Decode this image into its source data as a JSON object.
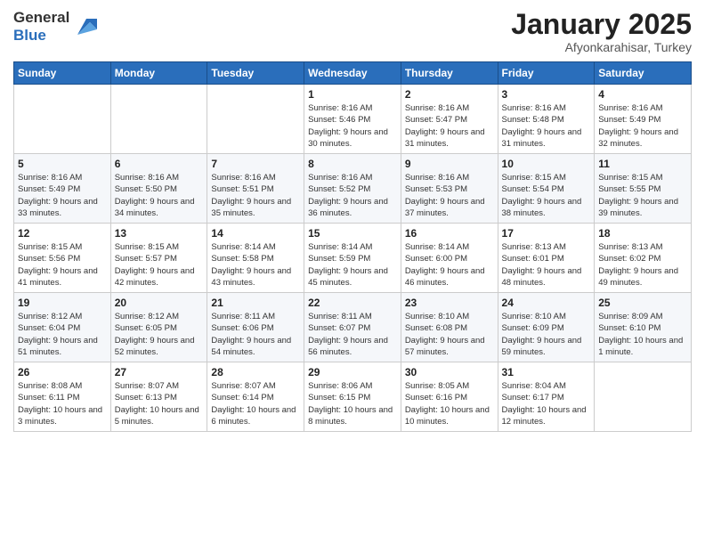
{
  "logo": {
    "line1": "General",
    "line2": "Blue"
  },
  "header": {
    "month": "January 2025",
    "location": "Afyonkarahisar, Turkey"
  },
  "weekdays": [
    "Sunday",
    "Monday",
    "Tuesday",
    "Wednesday",
    "Thursday",
    "Friday",
    "Saturday"
  ],
  "weeks": [
    [
      {
        "day": "",
        "sunrise": "",
        "sunset": "",
        "daylight": ""
      },
      {
        "day": "",
        "sunrise": "",
        "sunset": "",
        "daylight": ""
      },
      {
        "day": "",
        "sunrise": "",
        "sunset": "",
        "daylight": ""
      },
      {
        "day": "1",
        "sunrise": "Sunrise: 8:16 AM",
        "sunset": "Sunset: 5:46 PM",
        "daylight": "Daylight: 9 hours and 30 minutes."
      },
      {
        "day": "2",
        "sunrise": "Sunrise: 8:16 AM",
        "sunset": "Sunset: 5:47 PM",
        "daylight": "Daylight: 9 hours and 31 minutes."
      },
      {
        "day": "3",
        "sunrise": "Sunrise: 8:16 AM",
        "sunset": "Sunset: 5:48 PM",
        "daylight": "Daylight: 9 hours and 31 minutes."
      },
      {
        "day": "4",
        "sunrise": "Sunrise: 8:16 AM",
        "sunset": "Sunset: 5:49 PM",
        "daylight": "Daylight: 9 hours and 32 minutes."
      }
    ],
    [
      {
        "day": "5",
        "sunrise": "Sunrise: 8:16 AM",
        "sunset": "Sunset: 5:49 PM",
        "daylight": "Daylight: 9 hours and 33 minutes."
      },
      {
        "day": "6",
        "sunrise": "Sunrise: 8:16 AM",
        "sunset": "Sunset: 5:50 PM",
        "daylight": "Daylight: 9 hours and 34 minutes."
      },
      {
        "day": "7",
        "sunrise": "Sunrise: 8:16 AM",
        "sunset": "Sunset: 5:51 PM",
        "daylight": "Daylight: 9 hours and 35 minutes."
      },
      {
        "day": "8",
        "sunrise": "Sunrise: 8:16 AM",
        "sunset": "Sunset: 5:52 PM",
        "daylight": "Daylight: 9 hours and 36 minutes."
      },
      {
        "day": "9",
        "sunrise": "Sunrise: 8:16 AM",
        "sunset": "Sunset: 5:53 PM",
        "daylight": "Daylight: 9 hours and 37 minutes."
      },
      {
        "day": "10",
        "sunrise": "Sunrise: 8:15 AM",
        "sunset": "Sunset: 5:54 PM",
        "daylight": "Daylight: 9 hours and 38 minutes."
      },
      {
        "day": "11",
        "sunrise": "Sunrise: 8:15 AM",
        "sunset": "Sunset: 5:55 PM",
        "daylight": "Daylight: 9 hours and 39 minutes."
      }
    ],
    [
      {
        "day": "12",
        "sunrise": "Sunrise: 8:15 AM",
        "sunset": "Sunset: 5:56 PM",
        "daylight": "Daylight: 9 hours and 41 minutes."
      },
      {
        "day": "13",
        "sunrise": "Sunrise: 8:15 AM",
        "sunset": "Sunset: 5:57 PM",
        "daylight": "Daylight: 9 hours and 42 minutes."
      },
      {
        "day": "14",
        "sunrise": "Sunrise: 8:14 AM",
        "sunset": "Sunset: 5:58 PM",
        "daylight": "Daylight: 9 hours and 43 minutes."
      },
      {
        "day": "15",
        "sunrise": "Sunrise: 8:14 AM",
        "sunset": "Sunset: 5:59 PM",
        "daylight": "Daylight: 9 hours and 45 minutes."
      },
      {
        "day": "16",
        "sunrise": "Sunrise: 8:14 AM",
        "sunset": "Sunset: 6:00 PM",
        "daylight": "Daylight: 9 hours and 46 minutes."
      },
      {
        "day": "17",
        "sunrise": "Sunrise: 8:13 AM",
        "sunset": "Sunset: 6:01 PM",
        "daylight": "Daylight: 9 hours and 48 minutes."
      },
      {
        "day": "18",
        "sunrise": "Sunrise: 8:13 AM",
        "sunset": "Sunset: 6:02 PM",
        "daylight": "Daylight: 9 hours and 49 minutes."
      }
    ],
    [
      {
        "day": "19",
        "sunrise": "Sunrise: 8:12 AM",
        "sunset": "Sunset: 6:04 PM",
        "daylight": "Daylight: 9 hours and 51 minutes."
      },
      {
        "day": "20",
        "sunrise": "Sunrise: 8:12 AM",
        "sunset": "Sunset: 6:05 PM",
        "daylight": "Daylight: 9 hours and 52 minutes."
      },
      {
        "day": "21",
        "sunrise": "Sunrise: 8:11 AM",
        "sunset": "Sunset: 6:06 PM",
        "daylight": "Daylight: 9 hours and 54 minutes."
      },
      {
        "day": "22",
        "sunrise": "Sunrise: 8:11 AM",
        "sunset": "Sunset: 6:07 PM",
        "daylight": "Daylight: 9 hours and 56 minutes."
      },
      {
        "day": "23",
        "sunrise": "Sunrise: 8:10 AM",
        "sunset": "Sunset: 6:08 PM",
        "daylight": "Daylight: 9 hours and 57 minutes."
      },
      {
        "day": "24",
        "sunrise": "Sunrise: 8:10 AM",
        "sunset": "Sunset: 6:09 PM",
        "daylight": "Daylight: 9 hours and 59 minutes."
      },
      {
        "day": "25",
        "sunrise": "Sunrise: 8:09 AM",
        "sunset": "Sunset: 6:10 PM",
        "daylight": "Daylight: 10 hours and 1 minute."
      }
    ],
    [
      {
        "day": "26",
        "sunrise": "Sunrise: 8:08 AM",
        "sunset": "Sunset: 6:11 PM",
        "daylight": "Daylight: 10 hours and 3 minutes."
      },
      {
        "day": "27",
        "sunrise": "Sunrise: 8:07 AM",
        "sunset": "Sunset: 6:13 PM",
        "daylight": "Daylight: 10 hours and 5 minutes."
      },
      {
        "day": "28",
        "sunrise": "Sunrise: 8:07 AM",
        "sunset": "Sunset: 6:14 PM",
        "daylight": "Daylight: 10 hours and 6 minutes."
      },
      {
        "day": "29",
        "sunrise": "Sunrise: 8:06 AM",
        "sunset": "Sunset: 6:15 PM",
        "daylight": "Daylight: 10 hours and 8 minutes."
      },
      {
        "day": "30",
        "sunrise": "Sunrise: 8:05 AM",
        "sunset": "Sunset: 6:16 PM",
        "daylight": "Daylight: 10 hours and 10 minutes."
      },
      {
        "day": "31",
        "sunrise": "Sunrise: 8:04 AM",
        "sunset": "Sunset: 6:17 PM",
        "daylight": "Daylight: 10 hours and 12 minutes."
      },
      {
        "day": "",
        "sunrise": "",
        "sunset": "",
        "daylight": ""
      }
    ]
  ]
}
